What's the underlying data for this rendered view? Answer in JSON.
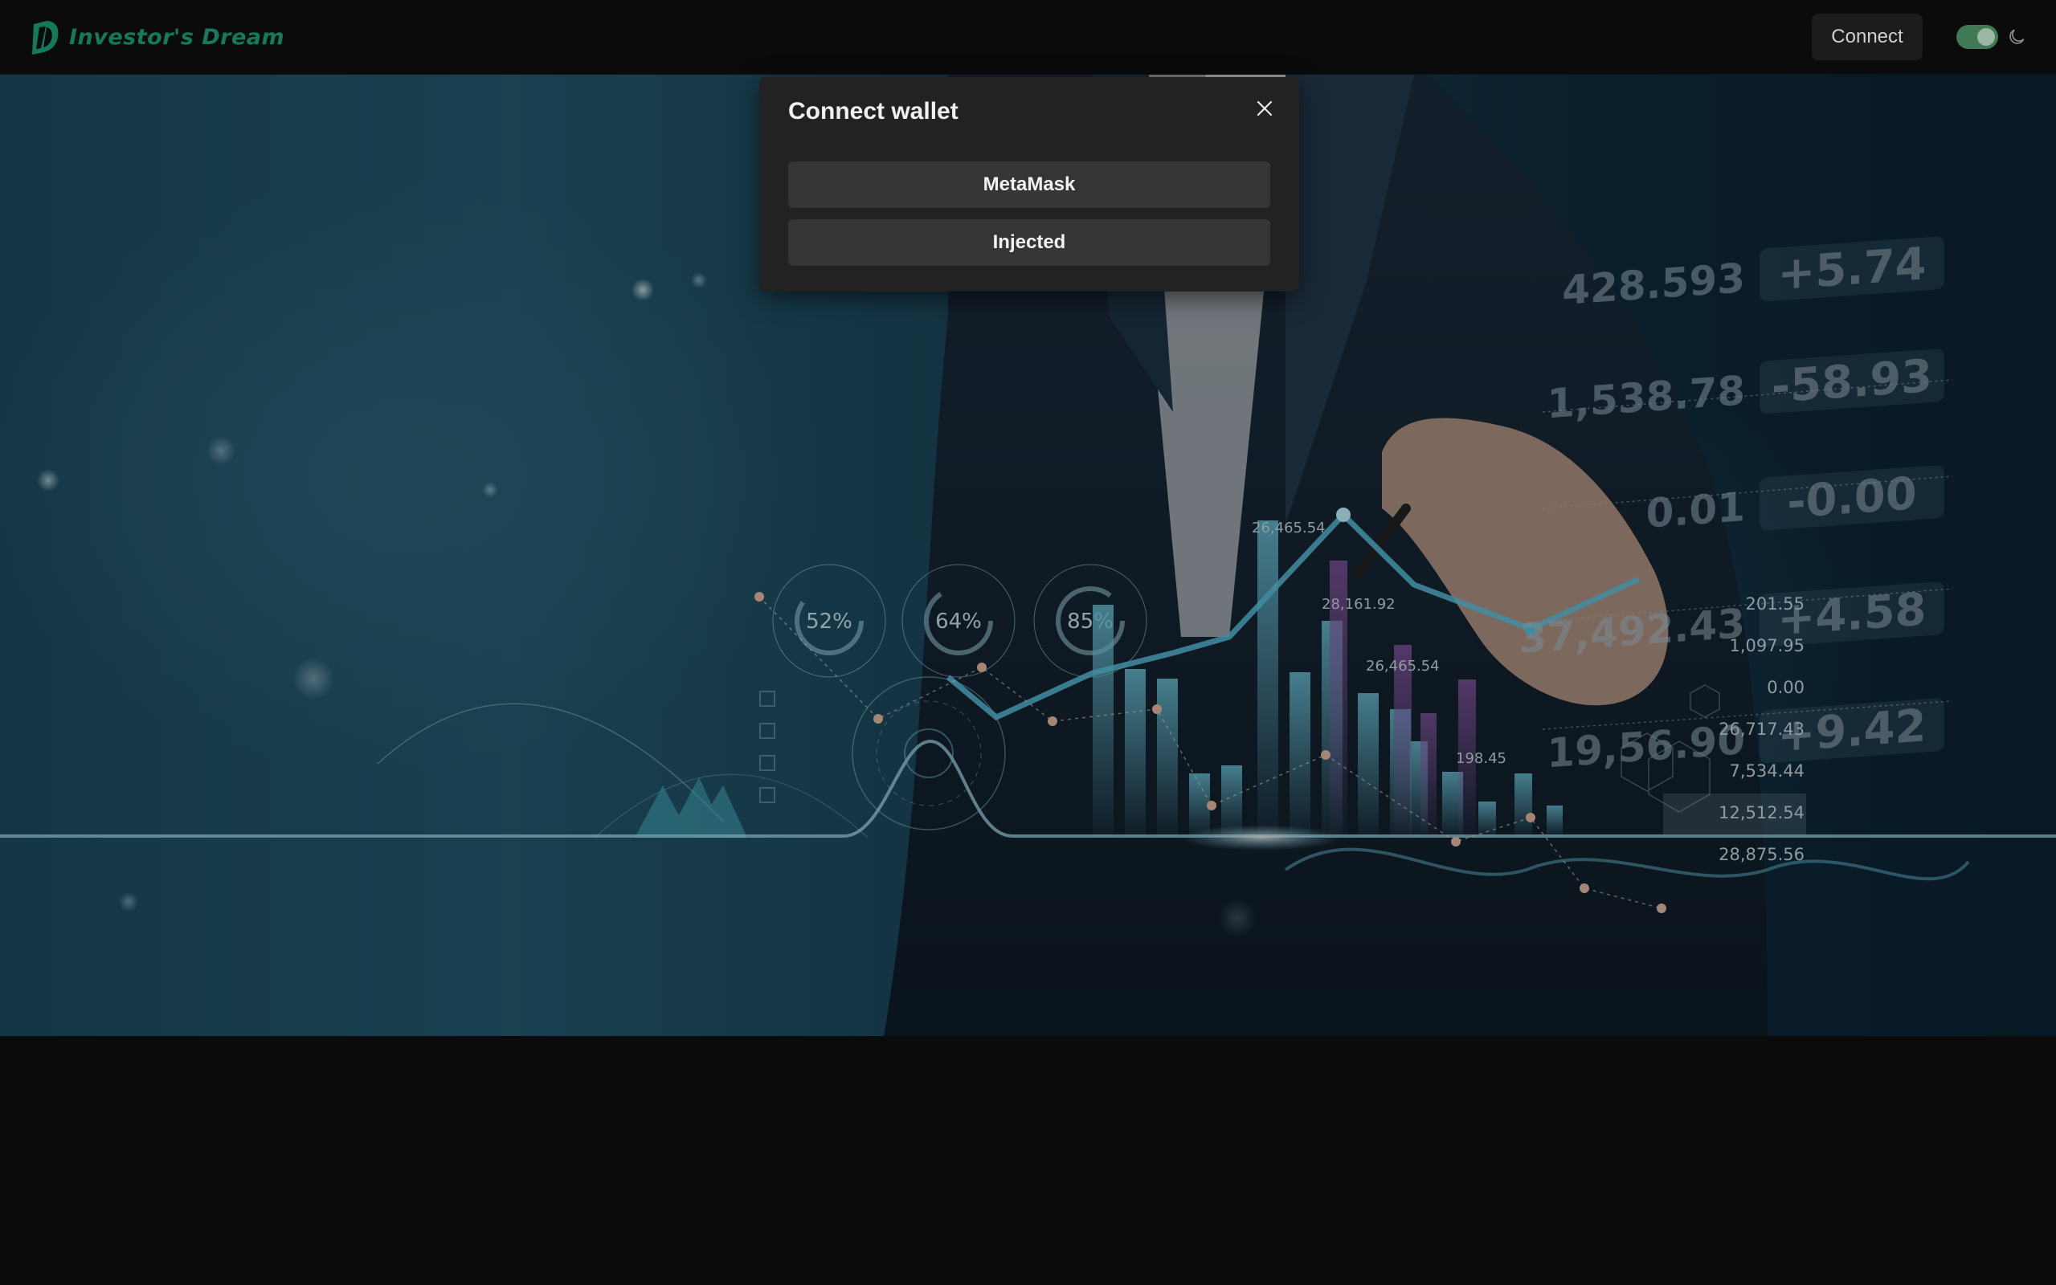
{
  "header": {
    "brand": "Investor's Dream",
    "connect_label": "Connect",
    "theme_toggle_on": true
  },
  "hero": {
    "gauges": [
      "52%",
      "64%",
      "85%"
    ],
    "chart_labels": [
      "26,465.54",
      "28,161.92",
      "26,465.54",
      "198.45"
    ],
    "ticker_rows": [
      {
        "value": "428.593",
        "change": "+5.74"
      },
      {
        "value": "1,538.78",
        "change": "-58.93"
      },
      {
        "value": "0.01",
        "change": "-0.00"
      },
      {
        "value": "37,492.43",
        "change": "+4.58"
      },
      {
        "value": "19,56.90",
        "change": "+9.42"
      }
    ],
    "value_list": [
      "201.55",
      "1,097.95",
      "0.00",
      "26,717.43",
      "7,534.44",
      "12,512.54",
      "28,875.56"
    ]
  },
  "modal": {
    "title": "Connect wallet",
    "options": [
      "MetaMask",
      "Injected"
    ]
  }
}
